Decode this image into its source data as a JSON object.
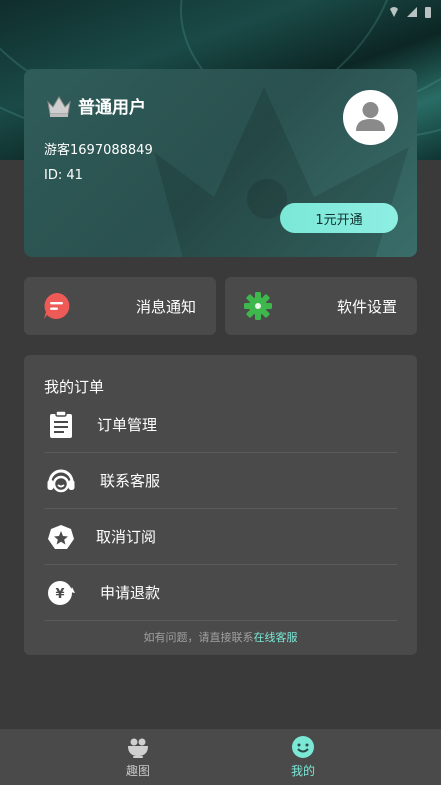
{
  "colors": {
    "background": "#3a3a3a",
    "panel": "#4a4a4a",
    "accent": "#7be8d6",
    "card": "#2f5c59"
  },
  "card": {
    "title": "普通用户",
    "guest": "游客1697088849",
    "uid": "ID: 41",
    "open_button": "1元开通"
  },
  "quick": {
    "messages": "消息通知",
    "settings": "软件设置"
  },
  "orders": {
    "heading": "我的订单",
    "items": [
      {
        "label": "订单管理",
        "icon": "clipboard-icon"
      },
      {
        "label": "联系客服",
        "icon": "headset-icon"
      },
      {
        "label": "取消订阅",
        "icon": "star-badge-icon"
      },
      {
        "label": "申请退款",
        "icon": "yen-refund-icon"
      }
    ],
    "note_prefix": "如有问题，请直接联系",
    "note_link": "在线客服"
  },
  "tabs": [
    {
      "label": "趣图",
      "icon": "bowl-icon",
      "active": false
    },
    {
      "label": "我的",
      "icon": "smiley-icon",
      "active": true
    }
  ]
}
